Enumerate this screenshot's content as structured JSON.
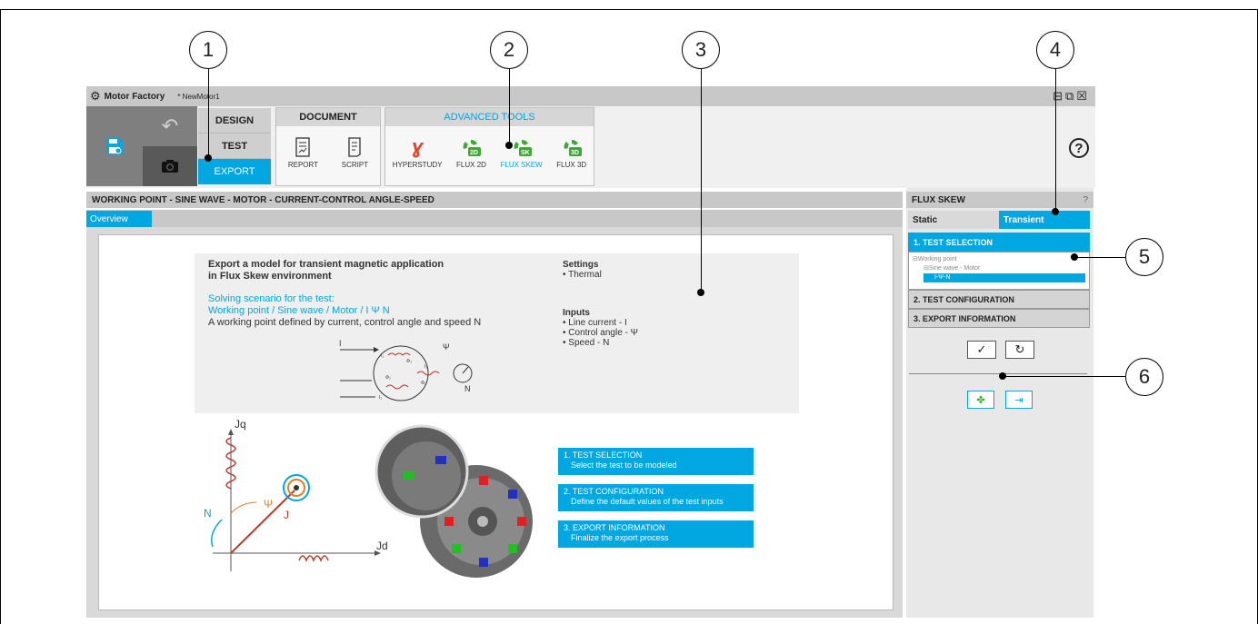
{
  "callouts": [
    "1",
    "2",
    "3",
    "4",
    "5",
    "6"
  ],
  "app": {
    "title": "Motor Factory",
    "file": "* NewMotor1",
    "window_controls": [
      "⊟",
      "⧉",
      "☒"
    ]
  },
  "ribbon": {
    "modes": [
      "DESIGN",
      "TEST",
      "EXPORT"
    ],
    "document": {
      "title": "DOCUMENT",
      "items": [
        {
          "label": "REPORT"
        },
        {
          "label": "SCRIPT"
        }
      ]
    },
    "advanced": {
      "title": "ADVANCED TOOLS",
      "items": [
        {
          "label": "HYPERSTUDY"
        },
        {
          "label": "FLUX 2D"
        },
        {
          "label": "FLUX SKEW"
        },
        {
          "label": "FLUX 3D"
        }
      ]
    },
    "help": "?"
  },
  "main": {
    "bar_title": "WORKING POINT - SINE WAVE - MOTOR - CURRENT-CONTROL ANGLE-SPEED",
    "tab": "Overview",
    "heading_line1": "Export a model for transient magnetic application",
    "heading_line2": "in Flux Skew environment",
    "scenario_title": "Solving scenario for the test:",
    "scenario_path": "Working point / Sine wave / Motor / I Ψ N",
    "scenario_desc": "A working point defined by current, control angle and speed N",
    "settings_title": "Settings",
    "settings": [
      "Thermal"
    ],
    "inputs_title": "Inputs",
    "inputs": [
      "Line current - I",
      "Control angle - Ψ",
      "Speed - N"
    ],
    "diagram": {
      "psi": "Ψ",
      "n": "N",
      "i": "I",
      "phi1": "Φ₁",
      "phi2": "Φ₂",
      "phi3": "Φ₃",
      "i1": "I₁",
      "i2": "I₂",
      "i3": "I₃"
    },
    "vector": {
      "jq": "Jq",
      "jd": "Jd",
      "psi": "Ψ",
      "j": "J",
      "n": "N"
    },
    "steps": [
      {
        "title": "1. TEST SELECTION",
        "desc": "Select the test to be modeled"
      },
      {
        "title": "2. TEST CONFIGURATION",
        "desc": "Define the default values of the test inputs"
      },
      {
        "title": "3. EXPORT INFORMATION",
        "desc": "Finalize the export process"
      }
    ]
  },
  "panel": {
    "title": "FLUX SKEW",
    "help": "?",
    "tabs": [
      "Static",
      "Transient"
    ],
    "sections": [
      "1. TEST SELECTION",
      "2. TEST CONFIGURATION",
      "3. EXPORT INFORMATION"
    ],
    "tree": [
      "⊟Working point",
      "⊟Sine wave - Motor",
      "I-Ψ-N"
    ]
  },
  "colors": {
    "accent": "#00a7e1",
    "hyperstudy": "#e8412b",
    "flux_green": "#3aaa35"
  }
}
